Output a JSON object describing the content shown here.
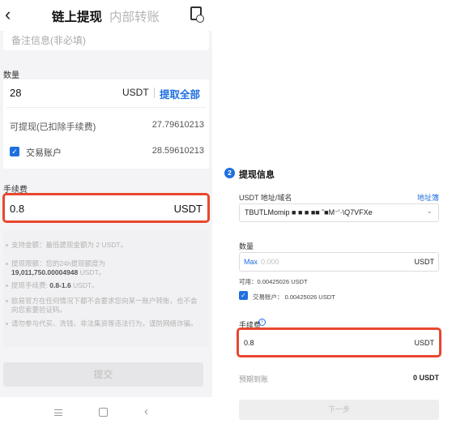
{
  "left": {
    "header": {
      "back_icon": "chevron-left",
      "tab_active": "链上提现",
      "tab_inactive": "内部转账",
      "record_icon": "record-clock-icon"
    },
    "memo_placeholder": "备注信息(非必填)",
    "amount": {
      "label": "数量",
      "value": "28",
      "unit": "USDT",
      "max_button": "提取全部",
      "available_label": "可提现(已扣除手续费)",
      "available_value": "27.79610213",
      "trading_label": "交易账户",
      "trading_value": "28.59610213"
    },
    "fee": {
      "label": "手续费",
      "value": "0.8",
      "unit": "USDT"
    },
    "notes": {
      "n1": "支持金额：最低提现金额为 2 USDT。",
      "n2_pre": "提现限额：您的24h提现额度为",
      "n2_amt": "19,011,750.00004948",
      "n2_unit": " USDT。",
      "n3_pre": "提现手续费: ",
      "n3_val": "0.8-1.6",
      "n3_unit": " USDT。",
      "n4": "欧易官方在任何情况下都不会要求您向某一账户转账，也不会向您索要验证码。",
      "n5": "请勿参与代买、洗钱、非法集资等违法行为，谨防网络诈骗。"
    },
    "submit": "提交"
  },
  "right": {
    "step_number": "2",
    "title": "提现信息",
    "address_label": "USDT 地址/域名",
    "address_book": "地址簿",
    "address_value": "TBUTLMomip ■ ■  ■ ■■ ˜■M⁻'·\\Q7VFXe",
    "amount_label": "数量",
    "max_label": "Max",
    "amount_placeholder": "0.000",
    "amount_unit": "USDT",
    "available": "可用：0.00425026 USDT",
    "trading": "交易账户：  0.00425026 USDT",
    "fee_label": "手续费",
    "fee_value": "0.8",
    "fee_unit": "USDT",
    "receive_label": "预期到账",
    "receive_value": "0 USDT",
    "next": "下一步"
  },
  "colors": {
    "accent": "#1f6fe0",
    "highlight": "#e8472e"
  }
}
